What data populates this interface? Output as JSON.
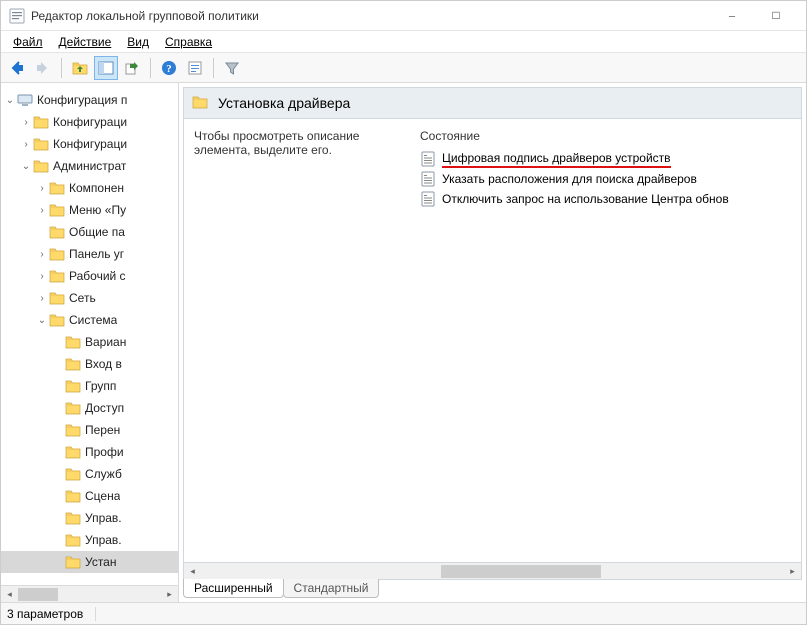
{
  "window": {
    "title": "Редактор локальной групповой политики"
  },
  "menu": {
    "file": "Файл",
    "action": "Действие",
    "view": "Вид",
    "help": "Справка"
  },
  "tree": {
    "root": "Конфигурация п",
    "cfg1": "Конфигураци",
    "cfg2": "Конфигураци",
    "admin": "Администрат",
    "components": "Компонен",
    "startmenu": "Меню «Пу",
    "sharedfolders": "Общие па",
    "controlpanel": "Панель уг",
    "desktop": "Рабочий с",
    "network": "Сеть",
    "system": "Система",
    "variants": "Вариан",
    "login": "Вход в",
    "group": "Групп",
    "access": "Доступ",
    "redir": "Перен",
    "profiles": "Профи",
    "services": "Служб",
    "scripts": "Сцена",
    "manage1": "Управ.",
    "manage2": "Управ.",
    "install": "Устан"
  },
  "content": {
    "header": "Установка драйвера",
    "description": "Чтобы просмотреть описание элемента, выделите его.",
    "column": "Состояние",
    "items": [
      "Цифровая подпись драйверов устройств",
      "Указать расположения для поиска драйверов",
      "Отключить запрос на использование Центра обнов"
    ]
  },
  "tabs": {
    "extended": "Расширенный",
    "standard": "Стандартный"
  },
  "status": {
    "count": "3 параметров"
  }
}
